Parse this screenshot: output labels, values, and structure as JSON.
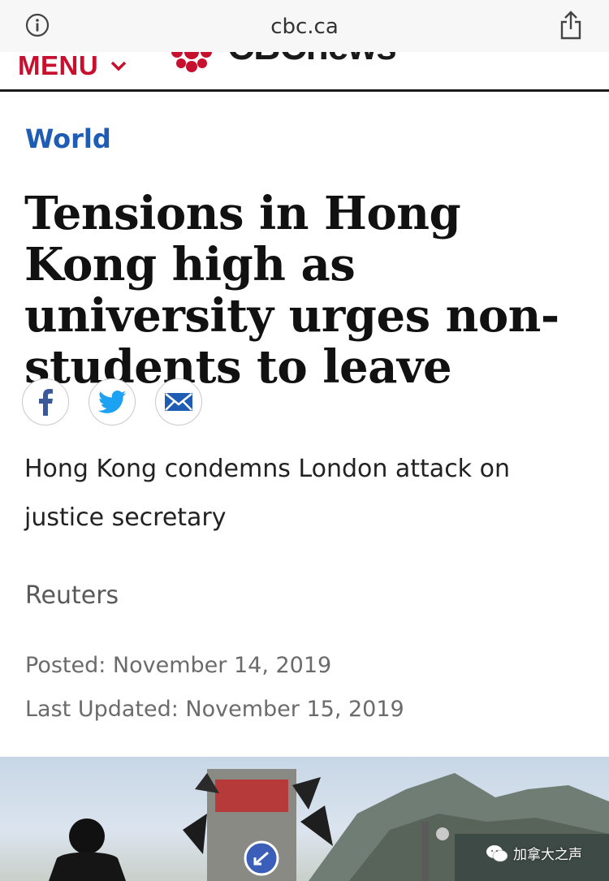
{
  "browser": {
    "url": "cbc.ca",
    "info_icon": "info-icon",
    "share_icon": "share-icon"
  },
  "site_header": {
    "menu_label": "MENU",
    "logo_text": "CBCnews",
    "brand_color": "#c8102e"
  },
  "article": {
    "section": "World",
    "headline": "Tensions in Hong Kong high as university urges non-students to leave",
    "share_buttons": [
      "facebook-icon",
      "twitter-icon",
      "email-icon"
    ],
    "deck": "Hong Kong condemns London attack on justice secretary",
    "byline": "Reuters",
    "posted": "Posted: November 14, 2019",
    "updated": "Last Updated: November 15, 2019"
  },
  "image": {
    "description_icon": "protest-photo",
    "watermark_text": "加拿大之声"
  },
  "colors": {
    "section_blue": "#1f5db5",
    "facebook_blue": "#3b5998",
    "twitter_blue": "#1da1f2",
    "email_blue": "#1f5db5"
  }
}
